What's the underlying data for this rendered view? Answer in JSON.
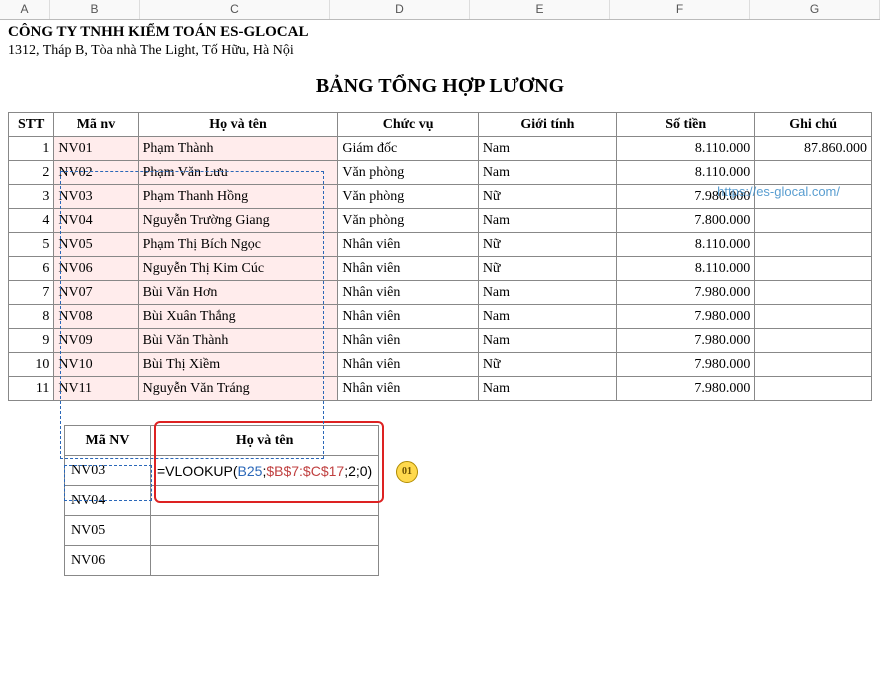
{
  "columns": [
    "A",
    "B",
    "C",
    "D",
    "E",
    "F",
    "G"
  ],
  "company": "CÔNG TY TNHH KIỂM TOÁN ES-GLOCAL",
  "address": "1312, Tháp B, Tòa nhà The Light, Tố Hữu, Hà Nội",
  "title": "BẢNG TỔNG HỢP LƯƠNG",
  "headers": {
    "stt": "STT",
    "manv": "Mã nv",
    "hoten": "Họ và tên",
    "chucvu": "Chức vụ",
    "gioitinh": "Giới tính",
    "sotien": "Số tiền",
    "ghichu": "Ghi chú"
  },
  "rows": [
    {
      "stt": "1",
      "manv": "NV01",
      "hoten": "Phạm Thành",
      "chucvu": "Giám đốc",
      "gioitinh": "Nam",
      "sotien": "8.110.000",
      "ghichu": "87.860.000"
    },
    {
      "stt": "2",
      "manv": "NV02",
      "hoten": "Phạm Văn Lưu",
      "chucvu": "Văn phòng",
      "gioitinh": "Nam",
      "sotien": "8.110.000",
      "ghichu": ""
    },
    {
      "stt": "3",
      "manv": "NV03",
      "hoten": "Phạm Thanh Hồng",
      "chucvu": "Văn phòng",
      "gioitinh": "Nữ",
      "sotien": "7.980.000",
      "ghichu": ""
    },
    {
      "stt": "4",
      "manv": "NV04",
      "hoten": "Nguyễn Trường Giang",
      "chucvu": "Văn phòng",
      "gioitinh": "Nam",
      "sotien": "7.800.000",
      "ghichu": ""
    },
    {
      "stt": "5",
      "manv": "NV05",
      "hoten": "Phạm Thị Bích Ngọc",
      "chucvu": "Nhân viên",
      "gioitinh": "Nữ",
      "sotien": "8.110.000",
      "ghichu": ""
    },
    {
      "stt": "6",
      "manv": "NV06",
      "hoten": "Nguyễn Thị Kim Cúc",
      "chucvu": "Nhân viên",
      "gioitinh": "Nữ",
      "sotien": "8.110.000",
      "ghichu": ""
    },
    {
      "stt": "7",
      "manv": "NV07",
      "hoten": "Bùi Văn Hơn",
      "chucvu": "Nhân viên",
      "gioitinh": "Nam",
      "sotien": "7.980.000",
      "ghichu": ""
    },
    {
      "stt": "8",
      "manv": "NV08",
      "hoten": "Bùi Xuân Thắng",
      "chucvu": "Nhân viên",
      "gioitinh": "Nam",
      "sotien": "7.980.000",
      "ghichu": ""
    },
    {
      "stt": "9",
      "manv": "NV09",
      "hoten": "Bùi Văn Thành",
      "chucvu": "Nhân viên",
      "gioitinh": "Nam",
      "sotien": "7.980.000",
      "ghichu": ""
    },
    {
      "stt": "10",
      "manv": "NV10",
      "hoten": "Bùi Thị Xiềm",
      "chucvu": "Nhân viên",
      "gioitinh": "Nữ",
      "sotien": "7.980.000",
      "ghichu": ""
    },
    {
      "stt": "11",
      "manv": "NV11",
      "hoten": "Nguyễn Văn Tráng",
      "chucvu": "Nhân viên",
      "gioitinh": "Nam",
      "sotien": "7.980.000",
      "ghichu": ""
    }
  ],
  "lookup": {
    "headers": {
      "manv": "Mã NV",
      "hoten": "Họ và tên"
    },
    "rows": [
      {
        "manv": "NV03",
        "formula_prefix": "=VLOOKUP(",
        "arg1": "B25",
        "sep1": ";",
        "arg2": "$B$7:$C$17",
        "sep2": ";2;0)"
      },
      {
        "manv": "NV04",
        "formula": ""
      },
      {
        "manv": "NV05",
        "formula": ""
      },
      {
        "manv": "NV06",
        "formula": ""
      }
    ],
    "step_badge": "01"
  },
  "watermark_url": "https://es-glocal.com/"
}
